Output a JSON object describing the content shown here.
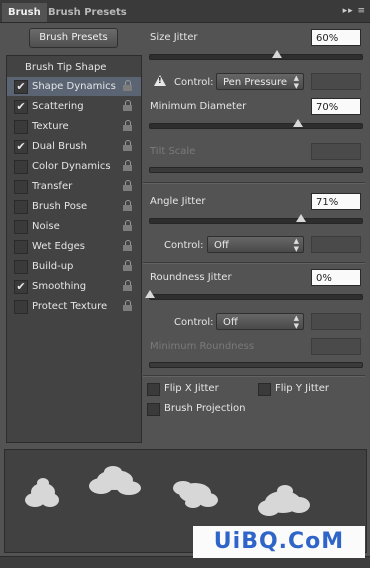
{
  "tabs": {
    "active": "Brush",
    "inactive": "Brush Presets"
  },
  "header_icons": "▸▸ ≡",
  "brush_presets_button": "Brush Presets",
  "left_items": [
    {
      "label": "Brush Tip Shape",
      "checked": false
    },
    {
      "label": "Shape Dynamics",
      "checked": true
    },
    {
      "label": "Scattering",
      "checked": true
    },
    {
      "label": "Texture",
      "checked": false
    },
    {
      "label": "Dual Brush",
      "checked": true
    },
    {
      "label": "Color Dynamics",
      "checked": false
    },
    {
      "label": "Transfer",
      "checked": false
    },
    {
      "label": "Brush Pose",
      "checked": false
    },
    {
      "label": "Noise",
      "checked": false
    },
    {
      "label": "Wet Edges",
      "checked": false
    },
    {
      "label": "Build-up",
      "checked": false
    },
    {
      "label": "Smoothing",
      "checked": true
    },
    {
      "label": "Protect Texture",
      "checked": false
    }
  ],
  "size_jitter": {
    "label": "Size Jitter",
    "value": "60%",
    "level": 0.6
  },
  "control1": {
    "label": "Control:",
    "value": "Pen Pressure"
  },
  "min_diameter": {
    "label": "Minimum Diameter",
    "value": "70%",
    "level": 0.7
  },
  "tilt_scale": {
    "label": "Tilt Scale"
  },
  "angle_jitter": {
    "label": "Angle Jitter",
    "value": "71%",
    "level": 0.71
  },
  "control2": {
    "label": "Control:",
    "value": "Off"
  },
  "roundness_jitter": {
    "label": "Roundness Jitter",
    "value": "0%",
    "level": 0.0
  },
  "control3": {
    "label": "Control:",
    "value": "Off"
  },
  "min_roundness": {
    "label": "Minimum Roundness"
  },
  "flip_x": "Flip X Jitter",
  "flip_y": "Flip Y Jitter",
  "brush_projection": "Brush Projection",
  "watermark": "UiBQ.CoM",
  "icons": [
    "checkbox-icon",
    "lock-icon",
    "warning-icon",
    "panel-menu-icon",
    "select-arrows-icon"
  ]
}
